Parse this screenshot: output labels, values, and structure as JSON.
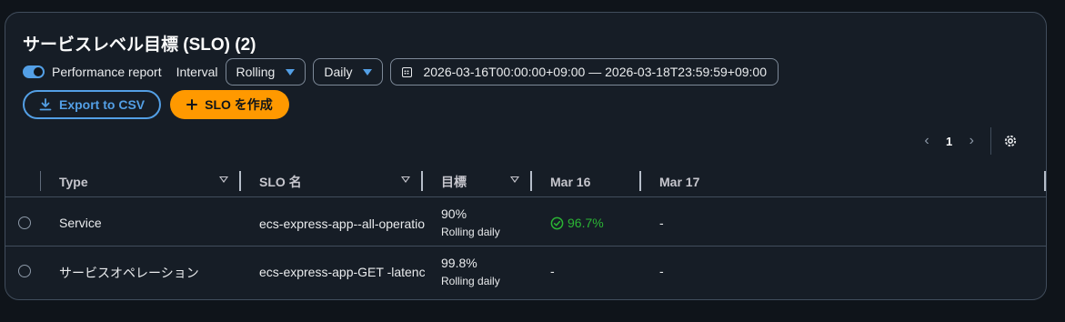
{
  "header": {
    "title": "サービスレベル目標 (SLO) (2)"
  },
  "toolbar": {
    "performance_report_label": "Performance report",
    "performance_report_enabled": true,
    "interval_label": "Interval",
    "interval_value": "Rolling",
    "granularity_value": "Daily",
    "date_range": "2026-03-16T00:00:00+09:00 — 2026-03-18T23:59:59+09:00"
  },
  "actions": {
    "export_label": "Export to CSV",
    "create_label": "SLO を作成"
  },
  "pagination": {
    "current_page": "1"
  },
  "table": {
    "columns": [
      "Type",
      "SLO 名",
      "目標",
      "Mar 16",
      "Mar 17"
    ],
    "rows": [
      {
        "type": "Service",
        "slo_name": "ecs-express-app--all-operations",
        "goal": "90%",
        "goal_sub": "Rolling daily",
        "mar16": "96.7%",
        "mar16_status": "ok",
        "mar17": "-"
      },
      {
        "type": "サービスオペレーション",
        "slo_name": "ecs-express-app-GET -latency",
        "goal": "99.8%",
        "goal_sub": "Rolling daily",
        "mar16": "-",
        "mar17": "-"
      }
    ]
  },
  "colors": {
    "accent": "#539fe5",
    "primary": "#ff9900",
    "success": "#2bb534",
    "background": "#161d26"
  }
}
